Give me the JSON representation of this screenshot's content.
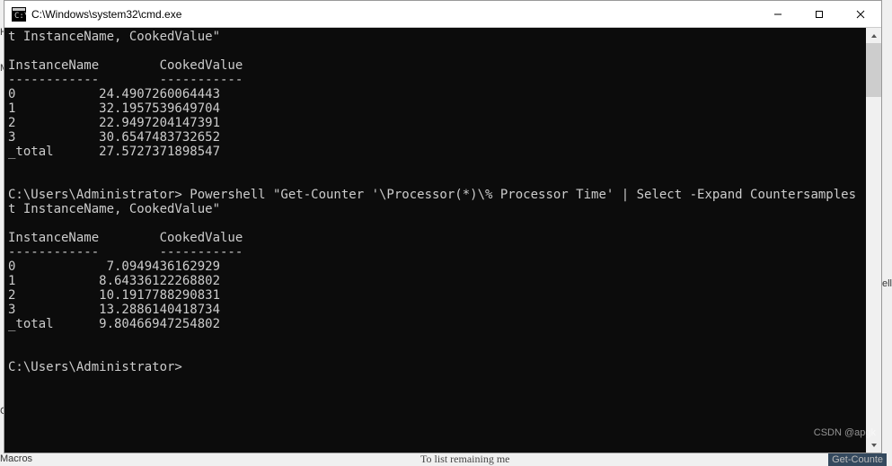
{
  "titlebar": {
    "title": "C:\\Windows\\system32\\cmd.exe"
  },
  "background": {
    "frag1": "HM",
    "frag2": "M",
    "frag3": "C0",
    "frag4": "Co",
    "frag5": "Macros",
    "frag_right": "ell"
  },
  "bottom": {
    "center": "To list remaining me",
    "right": "Get-Counte"
  },
  "watermark": "CSDN @apgk",
  "terminal": {
    "line_cont1": "t InstanceName, CookedValue\"",
    "blank": "",
    "header": "InstanceName        CookedValue",
    "divider": "------------        -----------",
    "set1": [
      {
        "name": "0",
        "value": "24.4907260064443"
      },
      {
        "name": "1",
        "value": "32.1957539649704"
      },
      {
        "name": "2",
        "value": "22.9497204147391"
      },
      {
        "name": "3",
        "value": "30.6547483732652"
      },
      {
        "name": "_total",
        "value": "27.5727371898547"
      }
    ],
    "prompt_line": "C:\\Users\\Administrator> Powershell \"Get-Counter '\\Processor(*)\\% Processor Time' | Select -Expand Countersamples | Selec",
    "line_cont2": "t InstanceName, CookedValue\"",
    "set2": [
      {
        "name": "0",
        "value": " 7.0949436162929"
      },
      {
        "name": "1",
        "value": "8.64336122268802"
      },
      {
        "name": "2",
        "value": "10.1917788290831"
      },
      {
        "name": "3",
        "value": "13.2886140418734"
      },
      {
        "name": "_total",
        "value": "9.80466947254802"
      }
    ],
    "prompt_idle": "C:\\Users\\Administrator>"
  }
}
